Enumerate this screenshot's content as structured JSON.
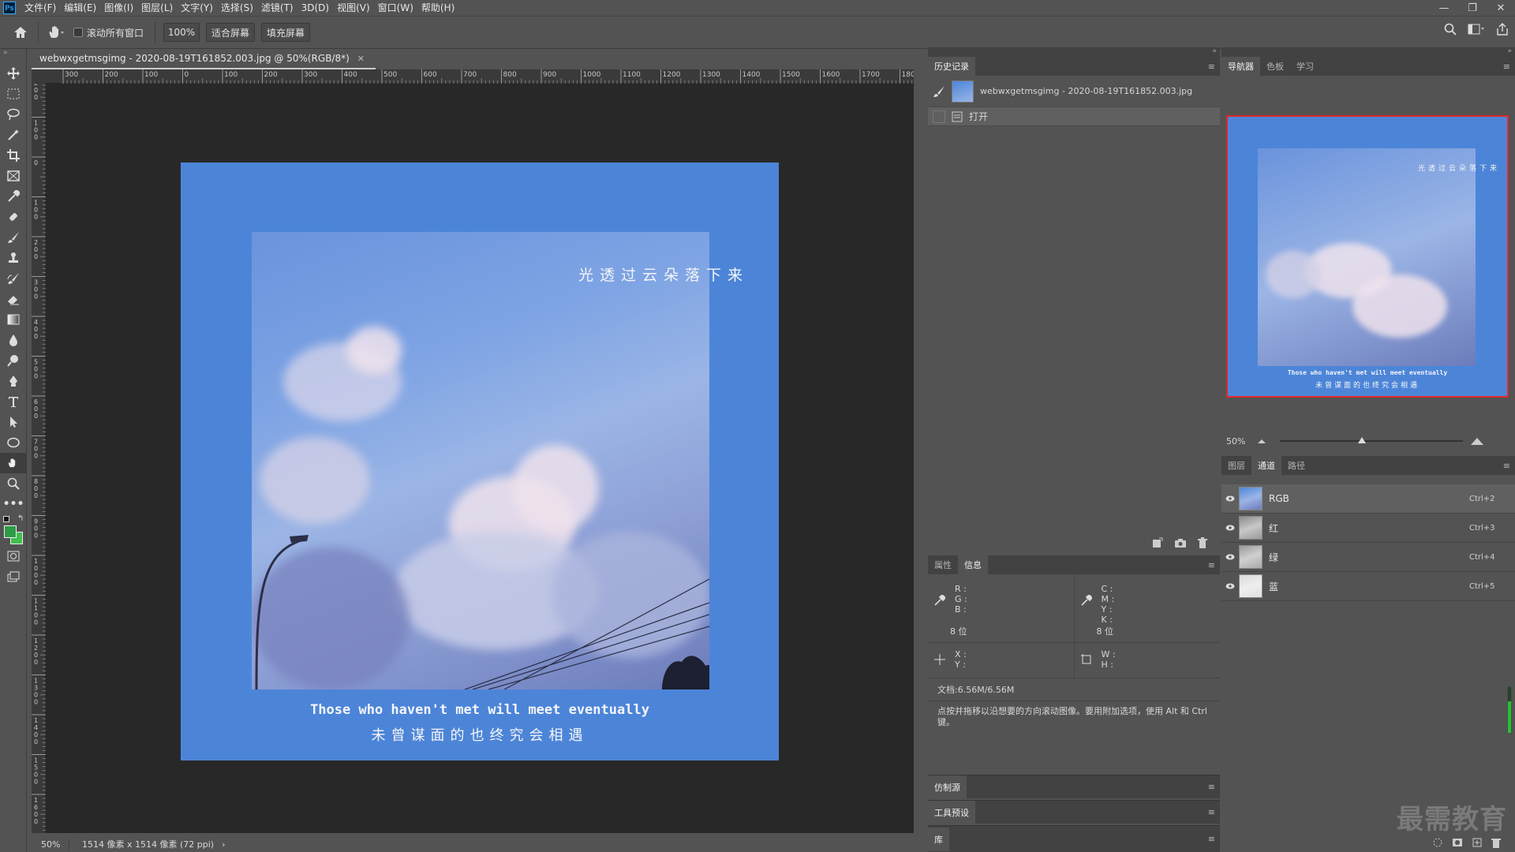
{
  "app": {
    "logo": "Ps"
  },
  "menu": [
    "文件(F)",
    "编辑(E)",
    "图像(I)",
    "图层(L)",
    "文字(Y)",
    "选择(S)",
    "滤镜(T)",
    "3D(D)",
    "视图(V)",
    "窗口(W)",
    "帮助(H)"
  ],
  "options": {
    "scroll_all_label": "滚动所有窗口",
    "zoom_value": "100%",
    "fit_screen_label": "适合屏幕",
    "fill_screen_label": "填充屏幕"
  },
  "document": {
    "tab_title": "webwxgetmsgimg - 2020-08-19T161852.003.jpg @ 50%(RGB/8*)",
    "ruler_top_labels": [
      "300",
      "200",
      "100",
      "0",
      "100",
      "200",
      "300",
      "400",
      "500",
      "600",
      "700",
      "800",
      "900",
      "1000",
      "1100",
      "1200",
      "1300",
      "1400",
      "1500",
      "1600",
      "1700",
      "1800"
    ],
    "ruler_left_labels": [
      "200",
      "100",
      "0",
      "100",
      "200",
      "300",
      "400",
      "500",
      "600",
      "700",
      "800",
      "900",
      "1000",
      "1100",
      "1200",
      "1300",
      "1400",
      "1500",
      "1600"
    ],
    "image_title": "光透过云朵落下来",
    "image_en": "Those who haven't met will meet eventually",
    "image_cn": "未曾谋面的也终究会相遇"
  },
  "status": {
    "zoom": "50%",
    "info": "1514 像素 x 1514 像素 (72 ppi)",
    "arrow": "›"
  },
  "history": {
    "tab": "历史记录",
    "snapshot": "webwxgetmsgimg - 2020-08-19T161852.003.jpg",
    "step": "打开"
  },
  "info_panel": {
    "tabs": [
      "属性",
      "信息"
    ],
    "rgb": [
      "R :",
      "G :",
      "B :"
    ],
    "cmyk": [
      "C :",
      "M :",
      "Y :",
      "K :"
    ],
    "bits_left": "8 位",
    "bits_right": "8 位",
    "xy": [
      "X :",
      "Y :"
    ],
    "wh": [
      "W :",
      "H :"
    ],
    "doc_size": "文档:6.56M/6.56M",
    "hint": "点按并拖移以沿想要的方向滚动图像。要用附加选项，使用 Alt 和 Ctrl 键。"
  },
  "collapsed_panels": [
    "仿制源",
    "工具预设",
    "库"
  ],
  "navigator": {
    "tabs": [
      "导航器",
      "色板",
      "学习"
    ],
    "zoom": "50%",
    "slider_value": 0.45
  },
  "channels": {
    "tabs": [
      "图层",
      "通道",
      "路径"
    ],
    "rows": [
      {
        "name": "RGB",
        "key": "Ctrl+2"
      },
      {
        "name": "红",
        "key": "Ctrl+3"
      },
      {
        "name": "绿",
        "key": "Ctrl+4"
      },
      {
        "name": "蓝",
        "key": "Ctrl+5"
      }
    ]
  },
  "watermark": "最需教育",
  "colors": {
    "foreground": "#2e9b47",
    "background": "#3ec04f",
    "image_bg": "#4c85d8",
    "nav_border": "#e02828"
  }
}
